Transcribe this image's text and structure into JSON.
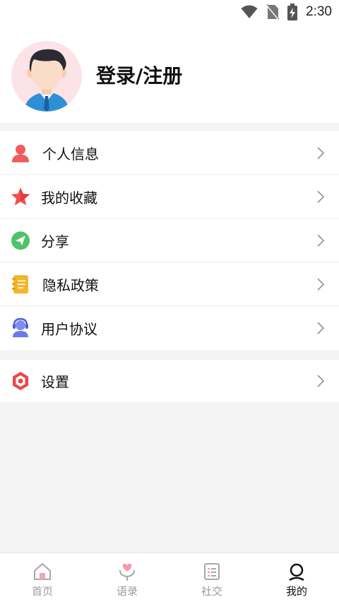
{
  "status_bar": {
    "time": "2:30",
    "icons": [
      "wifi-icon",
      "no-sim-icon",
      "battery-charging-icon"
    ]
  },
  "profile": {
    "login_label": "登录/注册",
    "avatar_icon": "user-avatar-icon"
  },
  "menu": {
    "group1": [
      {
        "label": "个人信息",
        "icon": "person-icon",
        "color": "#f25b5b"
      },
      {
        "label": "我的收藏",
        "icon": "star-icon",
        "color": "#f0504f"
      },
      {
        "label": "分享",
        "icon": "paper-plane-icon",
        "color": "#4fc26a"
      },
      {
        "label": "隐私政策",
        "icon": "notebook-icon",
        "color": "#f5b52a"
      },
      {
        "label": "用户协议",
        "icon": "headset-user-icon",
        "color": "#6a7be8"
      }
    ],
    "group2": [
      {
        "label": "设置",
        "icon": "hexagon-settings-icon",
        "color": "#e94a4a"
      }
    ]
  },
  "tabbar": {
    "items": [
      {
        "label": "首页",
        "icon": "home-icon",
        "active": false
      },
      {
        "label": "语录",
        "icon": "heart-hands-icon",
        "active": false
      },
      {
        "label": "社交",
        "icon": "list-icon",
        "active": false
      },
      {
        "label": "我的",
        "icon": "profile-icon",
        "active": true
      }
    ]
  }
}
